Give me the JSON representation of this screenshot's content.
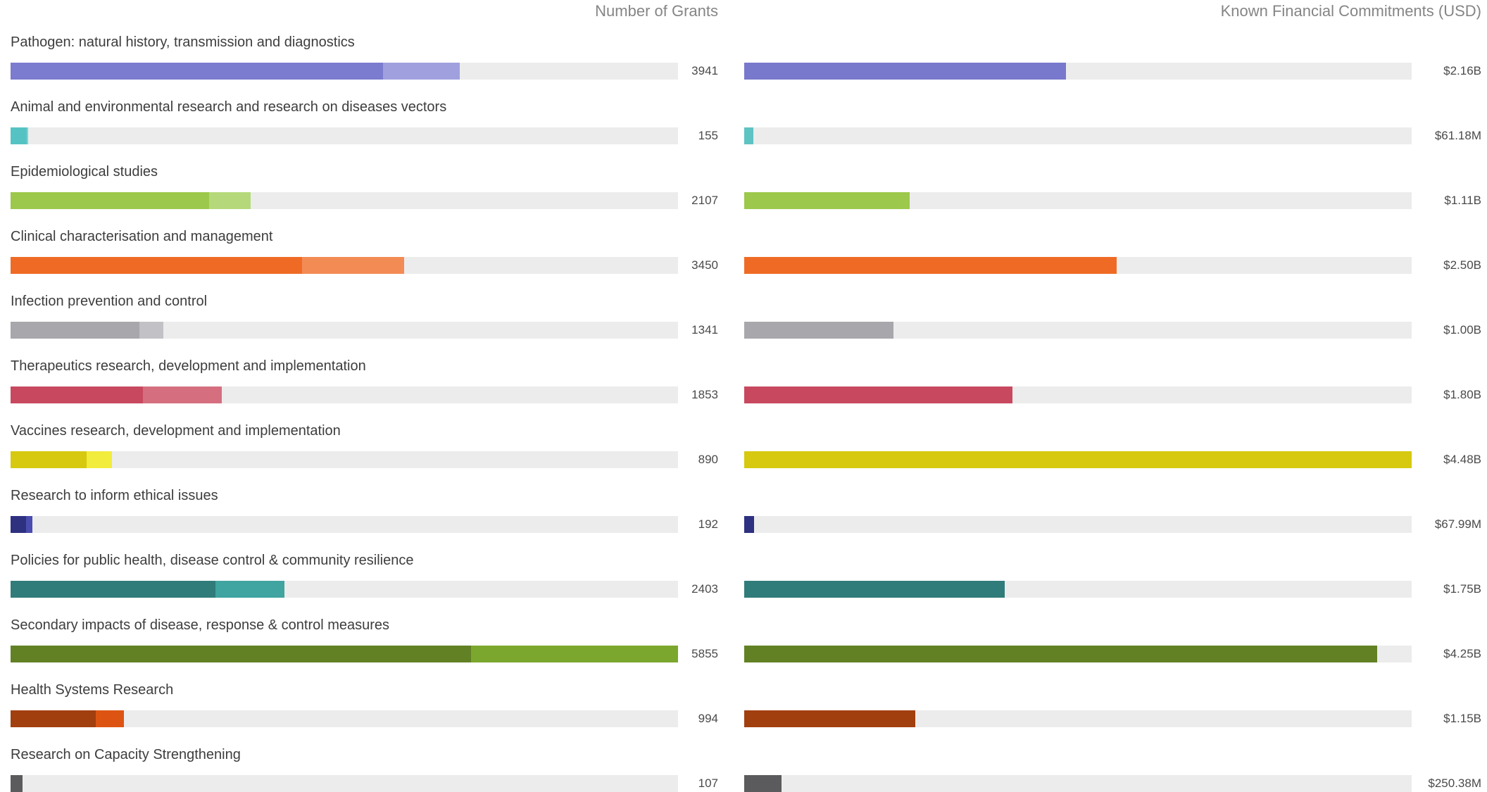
{
  "chart_data": [
    {
      "type": "bar",
      "title": "Number of Grants",
      "orientation": "horizontal",
      "stacked": true,
      "xlim": [
        0,
        5855
      ],
      "categories": [
        "Pathogen: natural history, transmission and diagnostics",
        "Animal and environmental research and research on diseases vectors",
        "Epidemiological studies",
        "Clinical characterisation and management",
        "Infection prevention and control",
        "Therapeutics research, development and implementation",
        "Vaccines research, development and implementation",
        "Research to inform ethical issues",
        "Policies for public health, disease control & community resilience",
        "Secondary impacts of disease, response & control measures",
        "Health Systems Research",
        "Research on Capacity Strengthening"
      ],
      "totals": [
        3941,
        155,
        2107,
        3450,
        1341,
        1853,
        890,
        192,
        2403,
        5855,
        994,
        107
      ],
      "value_labels": [
        "3941",
        "155",
        "2107",
        "3450",
        "1341",
        "1853",
        "890",
        "192",
        "2403",
        "5855",
        "994",
        "107"
      ],
      "series": [
        {
          "values": [
            3270,
            140,
            1740,
            2560,
            1130,
            1160,
            665,
            135,
            1800,
            4040,
            750,
            90
          ]
        },
        {
          "values": [
            671,
            15,
            367,
            890,
            211,
            693,
            225,
            57,
            603,
            1815,
            244,
            17
          ]
        }
      ],
      "colors": {
        "dark": [
          "#7b7bcf",
          "#55c3c3",
          "#9cc84b",
          "#ef6b25",
          "#a7a7ac",
          "#c8485f",
          "#d6c90f",
          "#2e3080",
          "#307c7a",
          "#628125",
          "#a23f0f",
          "#5b5b5e"
        ],
        "light": [
          "#a0a0df",
          "#7ad6d6",
          "#b5d97a",
          "#f38b55",
          "#c2c2c6",
          "#d56f7f",
          "#f2ec3c",
          "#4a4cb0",
          "#40a4a0",
          "#7ca72e",
          "#dd5412",
          "#5b5b5e"
        ]
      },
      "track_color": "#ececec"
    },
    {
      "type": "bar",
      "title": "Known Financial Commitments (USD)",
      "orientation": "horizontal",
      "xlim": [
        0,
        4.48
      ],
      "unit": "billion USD",
      "categories": [
        "Pathogen: natural history, transmission and diagnostics",
        "Animal and environmental research and research on diseases vectors",
        "Epidemiological studies",
        "Clinical characterisation and management",
        "Infection prevention and control",
        "Therapeutics research, development and implementation",
        "Vaccines research, development and implementation",
        "Research to inform ethical issues",
        "Policies for public health, disease control & community resilience",
        "Secondary impacts of disease, response & control measures",
        "Health Systems Research",
        "Research on Capacity Strengthening"
      ],
      "values": [
        2.16,
        0.06118,
        1.11,
        2.5,
        1.0,
        1.8,
        4.48,
        0.06799,
        1.75,
        4.25,
        1.15,
        0.25038
      ],
      "value_labels": [
        "$2.16B",
        "$61.18M",
        "$1.11B",
        "$2.50B",
        "$1.00B",
        "$1.80B",
        "$4.48B",
        "$67.99M",
        "$1.75B",
        "$4.25B",
        "$1.15B",
        "$250.38M"
      ],
      "colors": [
        "#7878cc",
        "#5ec3c3",
        "#9cc84b",
        "#ef6b25",
        "#a7a7ac",
        "#c8485f",
        "#d6c90f",
        "#2e3080",
        "#307c7a",
        "#628125",
        "#a23f0f",
        "#5b5b5e"
      ],
      "track_color": "#ececec"
    }
  ]
}
